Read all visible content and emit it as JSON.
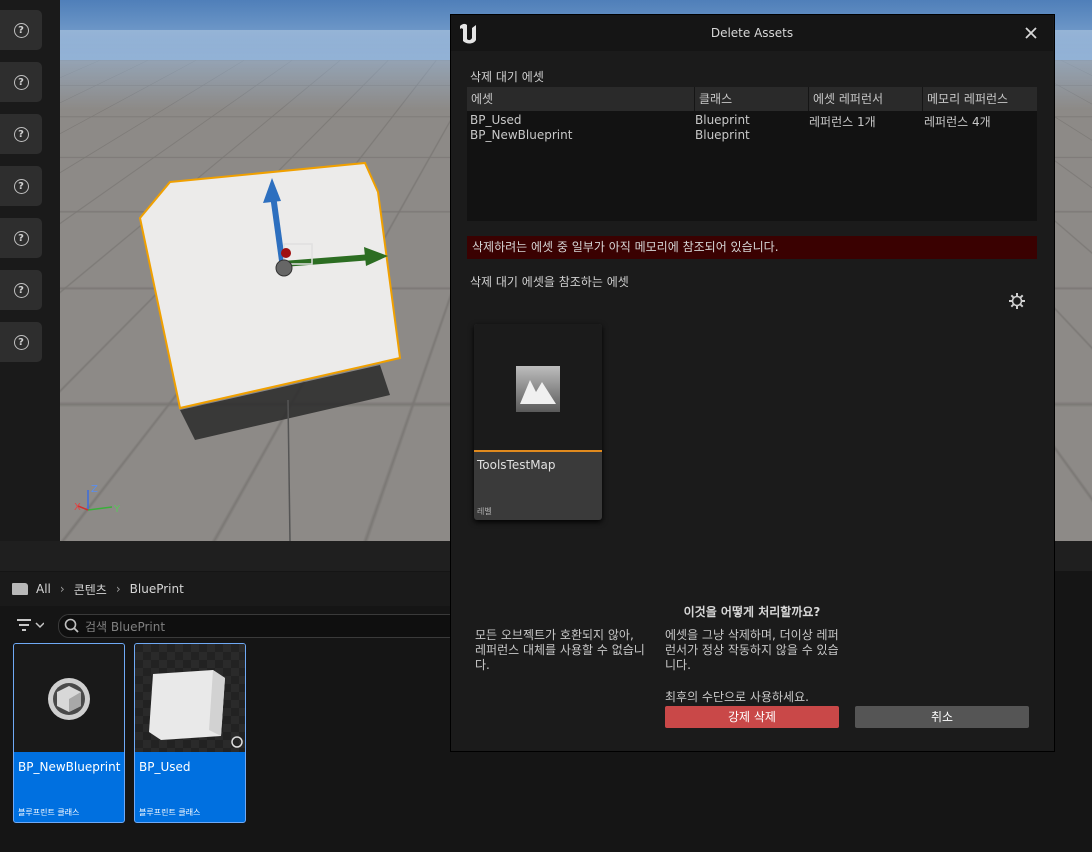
{
  "dialog": {
    "title": "Delete Assets",
    "pending_header": "삭제 대기 에셋",
    "columns": [
      "에셋",
      "클래스",
      "에셋 레퍼런서",
      "메모리 레퍼런스"
    ],
    "rows": [
      {
        "asset": "BP_Used",
        "class": "Blueprint",
        "asset_ref": "레퍼런스 1개",
        "mem_ref": "레퍼런스 4개"
      },
      {
        "asset": "BP_NewBlueprint",
        "class": "Blueprint",
        "asset_ref": "",
        "mem_ref": ""
      }
    ],
    "warning": "삭제하려는 에셋 중 일부가 아직 메모리에 참조되어 있습니다.",
    "referencing_header": "삭제 대기 에셋을 참조하는 에셋",
    "ref_asset": {
      "name": "ToolsTestMap",
      "type": "레벨"
    },
    "question": "이것을 어떻게 처리할까요?",
    "left_note": "모든 오브젝트가 호환되지 않아, 레퍼런스 대체를 사용할 수 없습니다.",
    "right_note": "에셋을 그냥 삭제하며, 더이상 레퍼런서가 정상 작동하지 않을 수 있습니다.",
    "last_resort": "최후의 수단으로 사용하세요.",
    "force_delete_label": "강제 삭제",
    "cancel_label": "취소",
    "force_color": "#c94848",
    "cancel_color": "#555555"
  },
  "content_browser": {
    "breadcrumbs": [
      "All",
      "콘텐츠",
      "BluePrint"
    ],
    "search_placeholder": "검색 BluePrint",
    "assets": [
      {
        "name": "BP_NewBlueprint",
        "type": "블루프린트 클래스"
      },
      {
        "name": "BP_Used",
        "type": "블루프린트 클래스"
      }
    ],
    "selection_color": "#0070e0"
  },
  "viewport": {
    "axis_labels": {
      "z": "Z",
      "x": "X",
      "y": "Y"
    }
  },
  "toolbar": {
    "help_icons": [
      "help-icon",
      "help-icon",
      "help-icon",
      "help-icon",
      "help-icon",
      "help-icon",
      "help-icon"
    ]
  },
  "accent_color": "#e08a1e"
}
